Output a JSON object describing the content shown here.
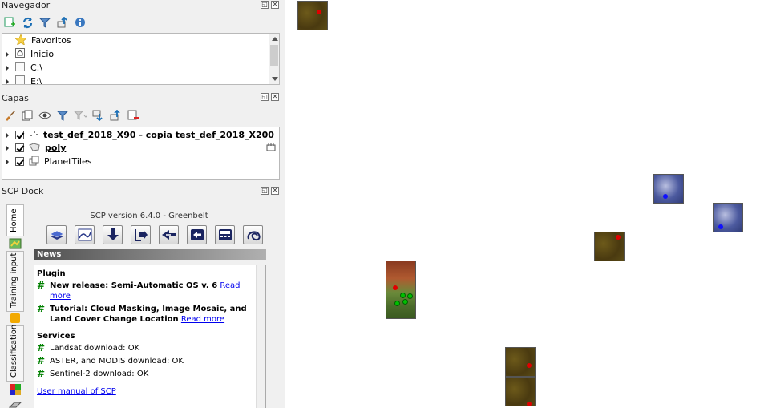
{
  "navigator": {
    "title": "Navegador",
    "items": [
      {
        "label": "Favoritos",
        "icon": "star-icon"
      },
      {
        "label": "Inicio",
        "icon": "home-icon"
      },
      {
        "label": "C:\\",
        "icon": "drive-icon"
      },
      {
        "label": "E:\\",
        "icon": "drive-icon"
      }
    ]
  },
  "layers": {
    "title": "Capas",
    "items": [
      {
        "label": "test_def_2018_X90 - copia test_def_2018_X200",
        "checked": true,
        "bold": true
      },
      {
        "label": "poly",
        "checked": true,
        "bold": true
      },
      {
        "label": "PlanetTiles",
        "checked": true,
        "bold": false
      }
    ]
  },
  "scp": {
    "title": "SCP Dock",
    "tabs": [
      "Home",
      "Training input",
      "Classification"
    ],
    "version": "SCP version 6.4.0 - Greenbelt",
    "news_label": "News",
    "plugin_heading": "Plugin",
    "plugin_items": [
      {
        "text": "New release: Semi-Automatic OS v. 6",
        "link": "Read more"
      },
      {
        "text": "Tutorial: Cloud Masking, Image Mosaic, and Land Cover Change Location",
        "link": "Read more"
      }
    ],
    "services_heading": "Services",
    "service_items": [
      "Landsat download: OK",
      "ASTER, and MODIS download: OK",
      "Sentinel-2 download: OK"
    ],
    "manual_link": "User manual of SCP"
  },
  "colors": {
    "accent_green": "#008000",
    "link_blue": "#0000ee",
    "point_red": "#e00000",
    "point_blue": "#1010ff"
  }
}
